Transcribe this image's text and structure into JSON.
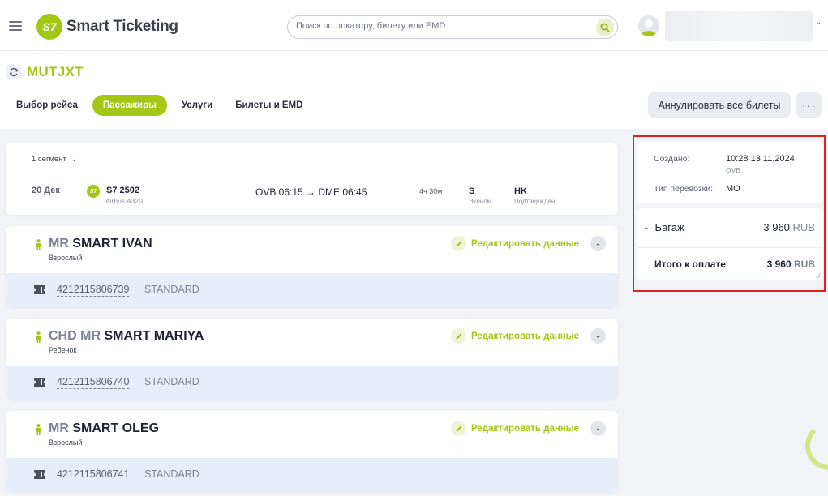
{
  "header": {
    "brand": "Smart Ticketing",
    "brand_badge": "S7",
    "search_placeholder": "Поиск по локатору, билету или EMD",
    "icons": [
      "menu-icon",
      "search-icon",
      "avatar-icon",
      "chevron-down-icon"
    ]
  },
  "booking": {
    "pnr": "MUTJXT",
    "tabs": [
      {
        "label": "Выбор рейса",
        "active": false
      },
      {
        "label": "Пассажиры",
        "active": true
      },
      {
        "label": "Услуги",
        "active": false
      },
      {
        "label": "Билеты и EMD",
        "active": false
      }
    ],
    "cancel_all_label": "Аннулировать все билеты",
    "more_label": "···"
  },
  "segment": {
    "toggle_label": "1 сегмент",
    "date": "20 Дек",
    "airline_badge": "S7",
    "flight": "S7 2502",
    "aircraft": "Airbus A320",
    "route": "OVB 06:15 → DME 06:45",
    "duration": "4ч 30м",
    "class_code": "S",
    "class_name": "Эконом",
    "status_code": "HK",
    "status_name": "Подтвержден"
  },
  "passengers": [
    {
      "title": "MR",
      "name": "SMART IVAN",
      "type": "Взрослый",
      "edit_label": "Редактировать данные",
      "ticket": "4212115806739",
      "fare": "STANDARD"
    },
    {
      "title": "CHD MR",
      "name": "SMART MARIYA",
      "type": "Ребенок",
      "edit_label": "Редактировать данные",
      "ticket": "4212115806740",
      "fare": "STANDARD"
    },
    {
      "title": "MR",
      "name": "SMART OLEG",
      "type": "Взрослый",
      "edit_label": "Редактировать данные",
      "ticket": "4212115806741",
      "fare": "STANDARD"
    }
  ],
  "summary": {
    "created_label": "Создано:",
    "created_value": "10:28 13.11.2024",
    "created_city": "OVB",
    "transport_label": "Тип перевозки:",
    "transport_value": "MO",
    "baggage_label": "Багаж",
    "baggage_amount": "3 960",
    "baggage_currency": "RUB",
    "total_label": "Итого к оплате",
    "total_amount": "3 960",
    "total_currency": "RUB"
  },
  "colors": {
    "brand": "#a4c615",
    "highlight_border": "#e0201b",
    "ticket_row_bg": "#e8edfa"
  }
}
